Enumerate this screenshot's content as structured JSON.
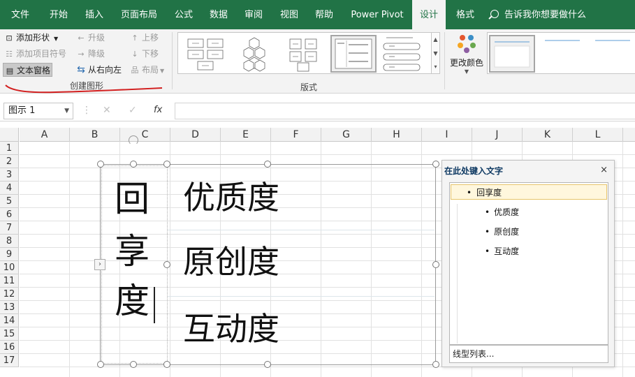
{
  "tabs": [
    "文件",
    "开始",
    "插入",
    "页面布局",
    "公式",
    "数据",
    "审阅",
    "视图",
    "帮助",
    "Power Pivot",
    "设计",
    "格式"
  ],
  "tell_me": "告诉我你想要做什么",
  "ribbon": {
    "add_shape": "添加形状",
    "add_bullet": "添加项目符号",
    "text_pane": "文本窗格",
    "promote": "升级",
    "demote": "降级",
    "rtl": "从右向左",
    "move_up": "上移",
    "move_down": "下移",
    "layout": "布局",
    "group_create": "创建图形",
    "group_layouts": "版式",
    "change_colors": "更改颜色"
  },
  "formula_bar": {
    "name_box": "图示 1",
    "fx": "fx"
  },
  "columns": [
    "A",
    "B",
    "C",
    "D",
    "E",
    "F",
    "G",
    "H",
    "I",
    "J",
    "K",
    "L"
  ],
  "rows": [
    "1",
    "2",
    "3",
    "4",
    "5",
    "6",
    "7",
    "8",
    "9",
    "10",
    "11",
    "12",
    "13",
    "14",
    "15",
    "16",
    "17"
  ],
  "smartart": {
    "title_chars": [
      "回",
      "享",
      "度"
    ],
    "items": [
      "优质度",
      "原创度",
      "互动度"
    ]
  },
  "text_pane": {
    "title": "在此处键入文字",
    "close": "×",
    "level1": "回享度",
    "level2": [
      "优质度",
      "原创度",
      "互动度"
    ],
    "footer_link": "线型列表..."
  },
  "colors": {
    "excel_green": "#217346",
    "ribbon_bg": "#f3f3f3",
    "annotation_red": "#d21f1f"
  }
}
